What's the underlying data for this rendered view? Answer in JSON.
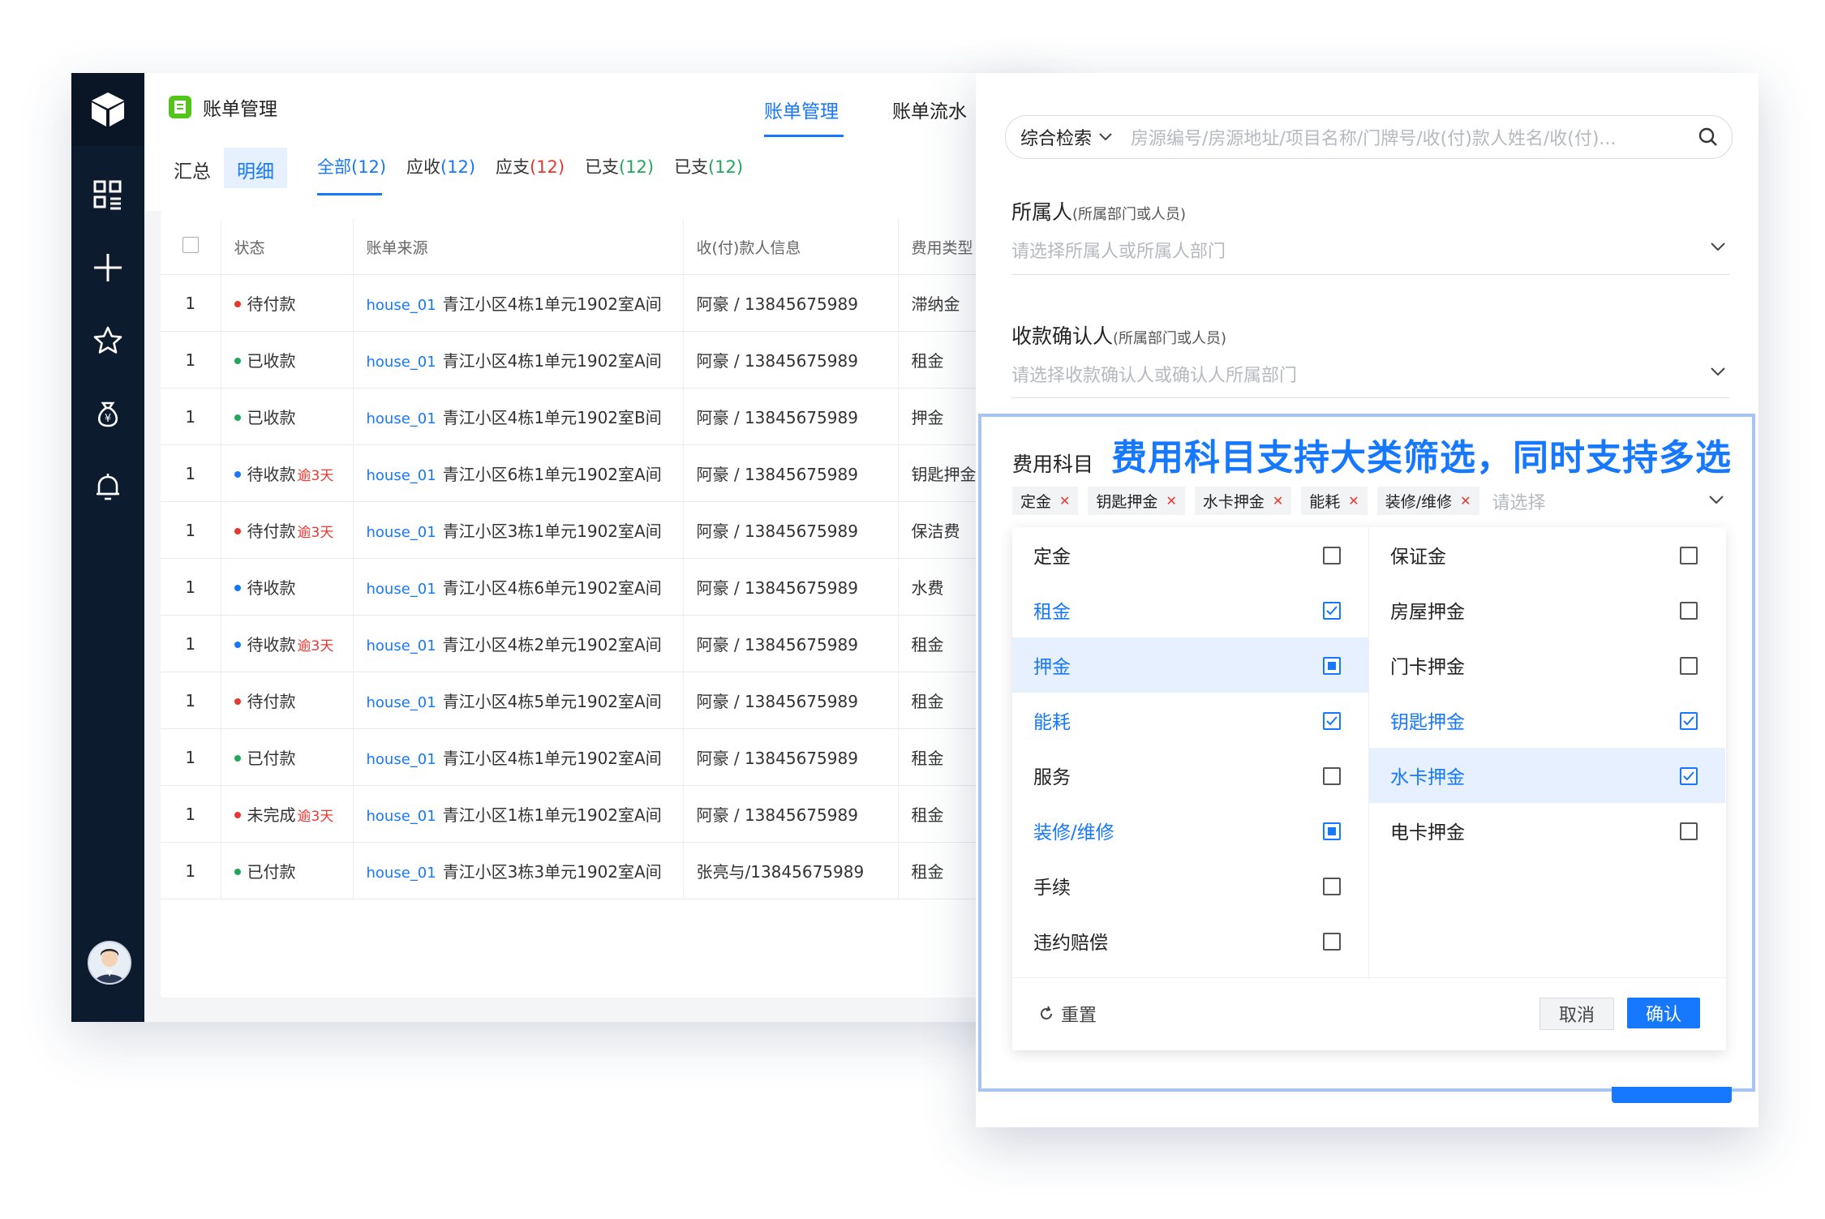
{
  "app": {
    "title": "账单管理",
    "top_tabs": [
      "账单管理",
      "账单流水"
    ],
    "segments": [
      "汇总",
      "明细"
    ],
    "filter_tabs": [
      {
        "label": "全部",
        "count": "(12)"
      },
      {
        "label": "应收",
        "count": "(12)"
      },
      {
        "label": "应支",
        "count": "(12)"
      },
      {
        "label": "已支",
        "count": "(12)"
      },
      {
        "label": "已支",
        "count": "(12)"
      }
    ]
  },
  "table": {
    "columns": [
      "状态",
      "账单来源",
      "收(付)款人信息",
      "费用类型"
    ],
    "rows": [
      {
        "n": "1",
        "status": "待付款",
        "status_color": "#e8382f",
        "overdue": "",
        "code": "house_01",
        "source": "青江小区4栋1单元1902室A间",
        "payer": "阿豪 / 13845675989",
        "type": "滞纳金"
      },
      {
        "n": "1",
        "status": "已收款",
        "status_color": "#22a85b",
        "overdue": "",
        "code": "house_01",
        "source": "青江小区4栋1单元1902室A间",
        "payer": "阿豪 / 13845675989",
        "type": "租金"
      },
      {
        "n": "1",
        "status": "已收款",
        "status_color": "#22a85b",
        "overdue": "",
        "code": "house_01",
        "source": "青江小区4栋1单元1902室B间",
        "payer": "阿豪 / 13845675989",
        "type": "押金"
      },
      {
        "n": "1",
        "status": "待收款",
        "status_color": "#1677ff",
        "overdue": "逾3天",
        "code": "house_01",
        "source": "青江小区6栋1单元1902室A间",
        "payer": "阿豪 / 13845675989",
        "type": "钥匙押金"
      },
      {
        "n": "1",
        "status": "待付款",
        "status_color": "#e8382f",
        "overdue": "逾3天",
        "code": "house_01",
        "source": "青江小区3栋1单元1902室A间",
        "payer": "阿豪 / 13845675989",
        "type": "保洁费"
      },
      {
        "n": "1",
        "status": "待收款",
        "status_color": "#1677ff",
        "overdue": "",
        "code": "house_01",
        "source": "青江小区4栋6单元1902室A间",
        "payer": "阿豪 / 13845675989",
        "type": "水费"
      },
      {
        "n": "1",
        "status": "待收款",
        "status_color": "#1677ff",
        "overdue": "逾3天",
        "code": "house_01",
        "source": "青江小区4栋2单元1902室A间",
        "payer": "阿豪 / 13845675989",
        "type": "租金"
      },
      {
        "n": "1",
        "status": "待付款",
        "status_color": "#e8382f",
        "overdue": "",
        "code": "house_01",
        "source": "青江小区4栋5单元1902室A间",
        "payer": "阿豪 / 13845675989",
        "type": "租金"
      },
      {
        "n": "1",
        "status": "已付款",
        "status_color": "#22a85b",
        "overdue": "",
        "code": "house_01",
        "source": "青江小区4栋1单元1902室A间",
        "payer": "阿豪 / 13845675989",
        "type": "租金"
      },
      {
        "n": "1",
        "status": "未完成",
        "status_color": "#e8382f",
        "overdue": "逾3天",
        "code": "house_01",
        "source": "青江小区1栋1单元1902室A间",
        "payer": "阿豪 / 13845675989",
        "type": "租金"
      },
      {
        "n": "1",
        "status": "已付款",
        "status_color": "#22a85b",
        "overdue": "",
        "code": "house_01",
        "source": "青江小区3栋3单元1902室A间",
        "payer": "张亮与/13845675989",
        "type": "租金"
      }
    ]
  },
  "panel": {
    "search_scope": "综合检索",
    "search_placeholder": "房源编号/房源地址/项目名称/门牌号/收(付)款人姓名/收(付)...",
    "owner_label": "所属人",
    "owner_hint": "(所属部门或人员)",
    "owner_placeholder": "请选择所属人或所属人部门",
    "confirmer_label": "收款确认人",
    "confirmer_hint": "(所属部门或人员)",
    "confirmer_placeholder": "请选择收款确认人或确认人所属部门",
    "fee_label": "费用科目",
    "promo": "费用科目支持大类筛选，同时支持多选",
    "chips": [
      "定金",
      "钥匙押金",
      "水卡押金",
      "能耗",
      "装修/维修"
    ],
    "chip_placeholder": "请选择",
    "left_options": [
      {
        "label": "定金",
        "state": "none",
        "highlight": false
      },
      {
        "label": "租金",
        "state": "checked",
        "highlight": false
      },
      {
        "label": "押金",
        "state": "partial",
        "highlight": true
      },
      {
        "label": "能耗",
        "state": "checked",
        "highlight": false
      },
      {
        "label": "服务",
        "state": "none",
        "highlight": false
      },
      {
        "label": "装修/维修",
        "state": "partial",
        "highlight": false
      },
      {
        "label": "手续",
        "state": "none",
        "highlight": false
      },
      {
        "label": "违约赔偿",
        "state": "none",
        "highlight": false
      }
    ],
    "right_options": [
      {
        "label": "保证金",
        "state": "none",
        "highlight": false
      },
      {
        "label": "房屋押金",
        "state": "none",
        "highlight": false
      },
      {
        "label": "门卡押金",
        "state": "none",
        "highlight": false
      },
      {
        "label": "钥匙押金",
        "state": "checked",
        "highlight": false
      },
      {
        "label": "水卡押金",
        "state": "checked",
        "highlight": true
      },
      {
        "label": "电卡押金",
        "state": "none",
        "highlight": false
      }
    ],
    "reset_label": "重置",
    "cancel_label": "取消",
    "confirm_label": "确认"
  },
  "colors": {
    "accent": "#1677ff",
    "sidebar": "#0d1b2e",
    "danger": "#e8382f",
    "success": "#22a85b"
  }
}
